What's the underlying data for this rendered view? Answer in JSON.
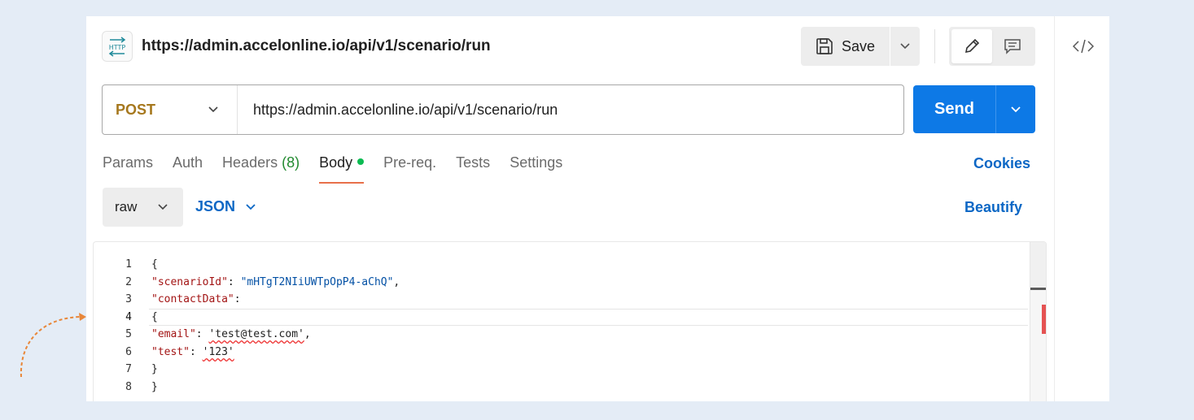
{
  "header": {
    "title": "https://admin.accelonline.io/api/v1/scenario/run",
    "protocol_icon_text": "HTTP",
    "save_label": "Save"
  },
  "request": {
    "method": "POST",
    "url": "https://admin.accelonline.io/api/v1/scenario/run",
    "send_label": "Send"
  },
  "tabs": [
    {
      "label": "Params"
    },
    {
      "label": "Auth"
    },
    {
      "label": "Headers",
      "count": "(8)"
    },
    {
      "label": "Body",
      "active": true,
      "indicator": "green-dot"
    },
    {
      "label": "Pre-req."
    },
    {
      "label": "Tests"
    },
    {
      "label": "Settings"
    }
  ],
  "cookies_label": "Cookies",
  "body": {
    "mode": "raw",
    "language": "JSON",
    "beautify_label": "Beautify",
    "line_numbers": [
      "1",
      "2",
      "3",
      "4",
      "5",
      "6",
      "7",
      "8"
    ],
    "lines": [
      "{",
      "\"scenarioId\": \"mHTgT2NIiUWTpOpP4-aChQ\",",
      "\"contactData\":",
      "{",
      "\"email\": 'test@test.com',",
      "\"test\": '123'",
      "}",
      "}"
    ],
    "tokens": {
      "open_brace": "{",
      "close_brace": "}",
      "colon": ": ",
      "comma": ",",
      "key_scenario": "\"scenarioId\"",
      "val_scenario": "\"mHTgT2NIiUWTpOpP4-aChQ\"",
      "key_contact": "\"contactData\"",
      "key_email": "\"email\"",
      "val_email": "'test@test.com'",
      "key_test": "\"test\"",
      "val_test": "'123'"
    },
    "current_line": 4
  },
  "colors": {
    "accent_blue": "#0d79e6",
    "link_blue": "#0b67c5",
    "method_post": "#a6781e",
    "tab_underline": "#e8704a",
    "status_green": "#0cbb52",
    "annotation_arrow": "#e8873a"
  },
  "icons": [
    "http-icon",
    "save-icon",
    "chevron-down-icon",
    "pencil-icon",
    "comment-icon",
    "code-icon"
  ]
}
